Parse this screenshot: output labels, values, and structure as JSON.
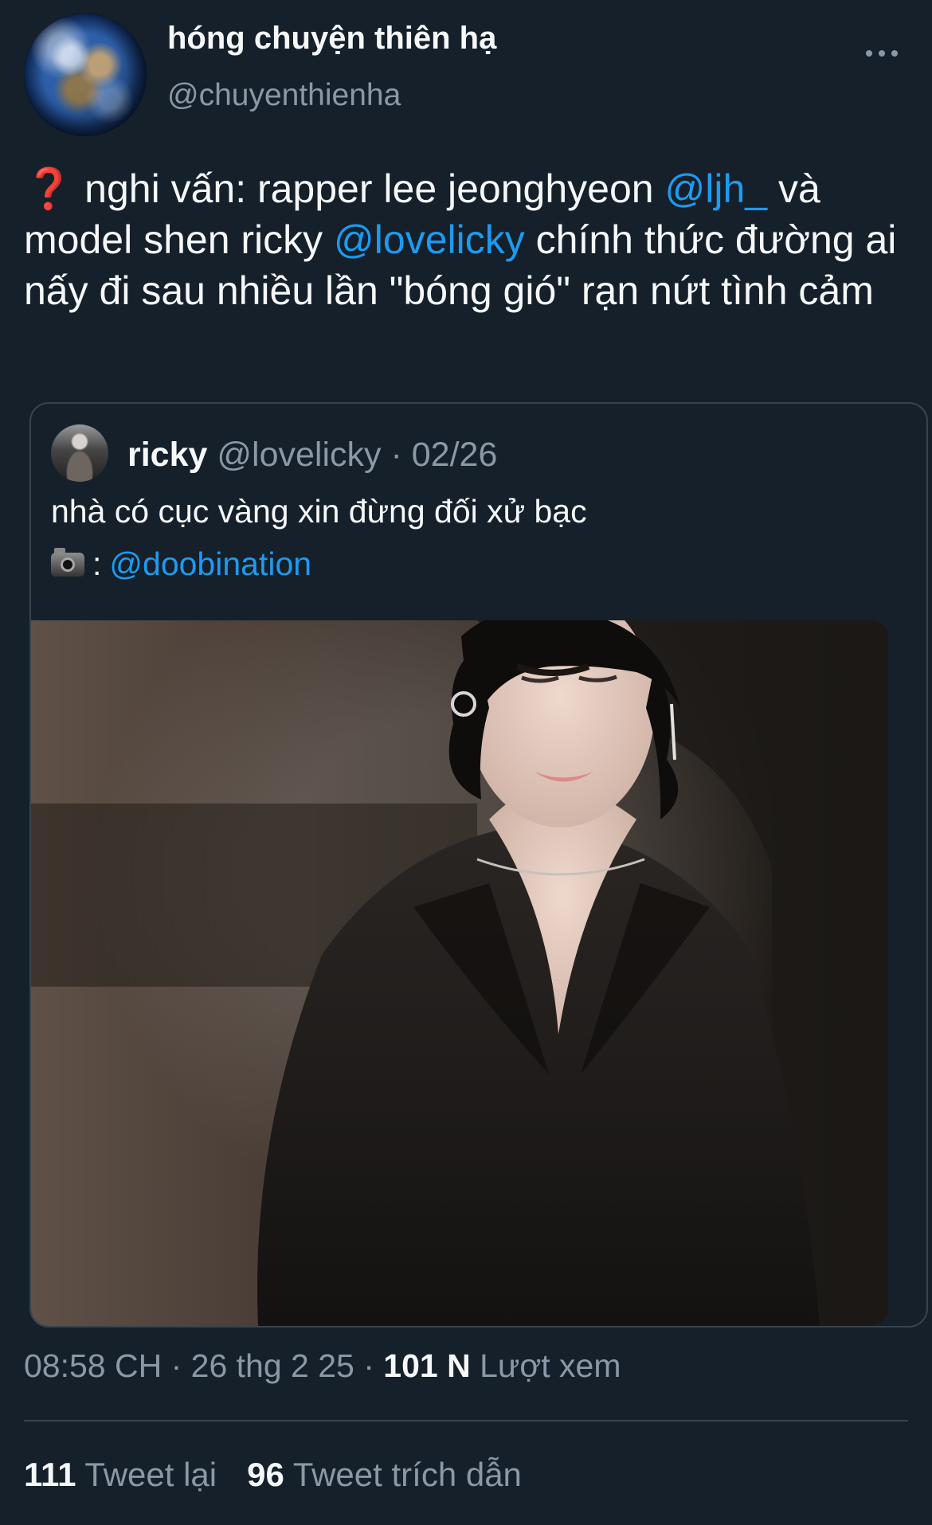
{
  "author": {
    "display_name": "hóng chuyện thiên hạ",
    "handle": "@chuyenthienha",
    "avatar_icon": "earth-icon"
  },
  "tweet": {
    "prefix": "❓",
    "text_1": " nghi vấn: rapper lee jeonghyeon ",
    "mention_1": "@ljh_",
    "text_2": " và model shen ricky ",
    "mention_2": "@lovelicky",
    "text_3": " chính thức đường ai nấy đi sau nhiều lần \"bóng gió\" rạn nứt tình cảm"
  },
  "quoted_tweet": {
    "name": "ricky",
    "handle": "@lovelicky",
    "date_sep": " · ",
    "date": "02/26",
    "text": "nhà có cục vàng xin đừng đối xử bạc",
    "credit_prefix": " : ",
    "credit_mention": "@doobination",
    "credit_icon": "camera-flash-icon"
  },
  "meta": {
    "time": "08:58 CH",
    "sep1": " · ",
    "date": "26 thg 2 25",
    "sep2": " · ",
    "views": "101 N",
    "views_label": " Lượt xem"
  },
  "engagement": {
    "retweets_count": "111",
    "retweets_label": "Tweet lại",
    "quotes_count": "96",
    "quotes_label": "Tweet trích dẫn"
  },
  "colors": {
    "background": "#15202b",
    "accent": "#1d9bf0",
    "muted": "#8b98a5"
  }
}
